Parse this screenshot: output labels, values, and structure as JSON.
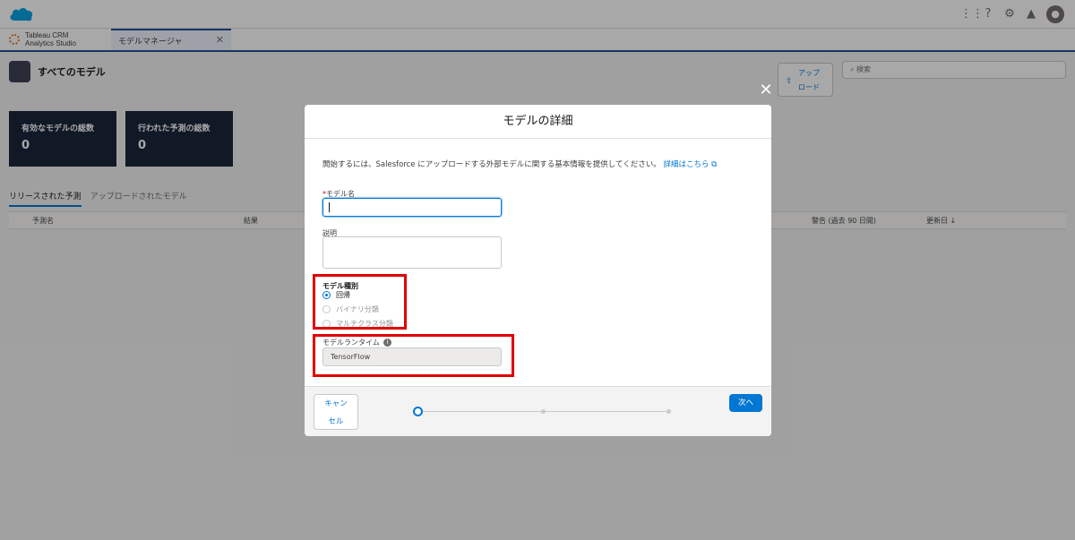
{
  "header": {
    "icons": [
      "app-launcher-icon",
      "help-icon",
      "setup-gear-icon",
      "notification-bell-icon",
      "user-avatar-icon"
    ]
  },
  "app": {
    "name_line1": "Tableau CRM",
    "name_line2": "Analytics Studio",
    "tab_label": "モデルマネージャ",
    "tab_close": "✕"
  },
  "page": {
    "title": "すべてのモデル",
    "upload_line1": "アップ",
    "upload_line2": "ロード",
    "search_placeholder": "検索"
  },
  "stats": [
    {
      "label": "有効なモデルの総数",
      "value": "0"
    },
    {
      "label": "行われた予測の総数",
      "value": "0"
    }
  ],
  "subtabs": {
    "released": "リリースされた予測",
    "uploaded": "アップロードされたモデル"
  },
  "columns": {
    "prediction_name": "予測名",
    "result": "結果",
    "warning": "警告 (過去 90 日間)",
    "updated": "更新日 ↓"
  },
  "modal": {
    "close": "✕",
    "title": "モデルの詳細",
    "intro": "開始するには、Salesforce にアップロードする外部モデルに関する基本情報を提供してください。",
    "learn_more": "詳細はこちら",
    "name_required": "*",
    "name_label": "モデル名",
    "desc_label": "説明",
    "type_label": "モデル種別",
    "types": [
      "回帰",
      "バイナリ分類",
      "マルチクラス分類"
    ],
    "runtime_label": "モデルランタイム",
    "runtime_value": "TensorFlow",
    "cancel_line1": "キャン",
    "cancel_line2": "セル",
    "next": "次へ"
  },
  "colors": {
    "brand_blue": "#0176d3",
    "highlight_red": "#e00000",
    "stat_card_bg": "#16243a"
  }
}
